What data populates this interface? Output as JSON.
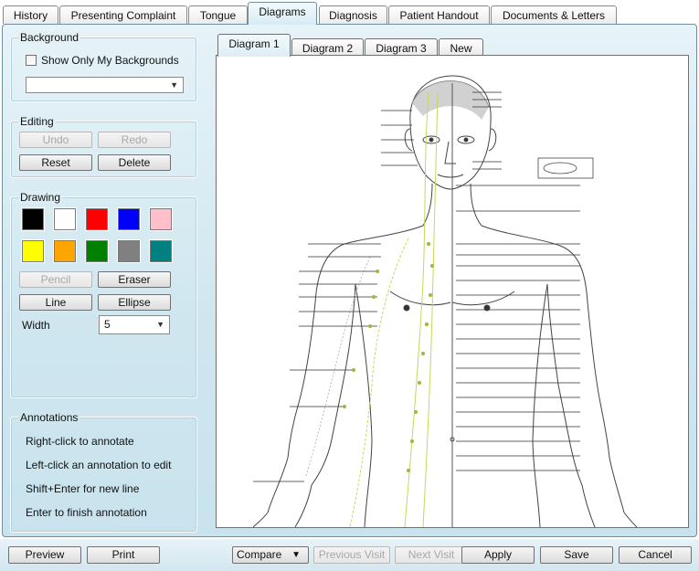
{
  "tabs": [
    "History",
    "Presenting Complaint",
    "Tongue",
    "Diagrams",
    "Diagnosis",
    "Patient Handout",
    "Documents & Letters"
  ],
  "active_tab": "Diagrams",
  "background": {
    "title": "Background",
    "show_only_label": "Show Only My Backgrounds",
    "show_only_checked": false,
    "selected": ""
  },
  "editing": {
    "title": "Editing",
    "undo": "Undo",
    "redo": "Redo",
    "reset": "Reset",
    "delete": "Delete"
  },
  "drawing": {
    "title": "Drawing",
    "colors": [
      "#000000",
      "#ffffff",
      "#ff0000",
      "#0000ff",
      "#ffc0cb",
      "#ffff00",
      "#ffa500",
      "#008000",
      "#808080",
      "#008080"
    ],
    "pencil": "Pencil",
    "eraser": "Eraser",
    "line": "Line",
    "ellipse": "Ellipse",
    "width_label": "Width",
    "width_value": "5"
  },
  "annotations": {
    "title": "Annotations",
    "lines": [
      "Right-click to annotate",
      "Left-click an annotation to edit",
      "Shift+Enter for new line",
      "Enter to finish annotation"
    ]
  },
  "diagram_tabs": [
    "Diagram 1",
    "Diagram 2",
    "Diagram 3",
    "New"
  ],
  "active_diagram_tab": "Diagram 1",
  "bottom": {
    "preview": "Preview",
    "print": "Print",
    "compare": "Compare",
    "previous_visit": "Previous Visit",
    "next_visit": "Next Visit",
    "apply": "Apply",
    "save": "Save",
    "cancel": "Cancel"
  }
}
